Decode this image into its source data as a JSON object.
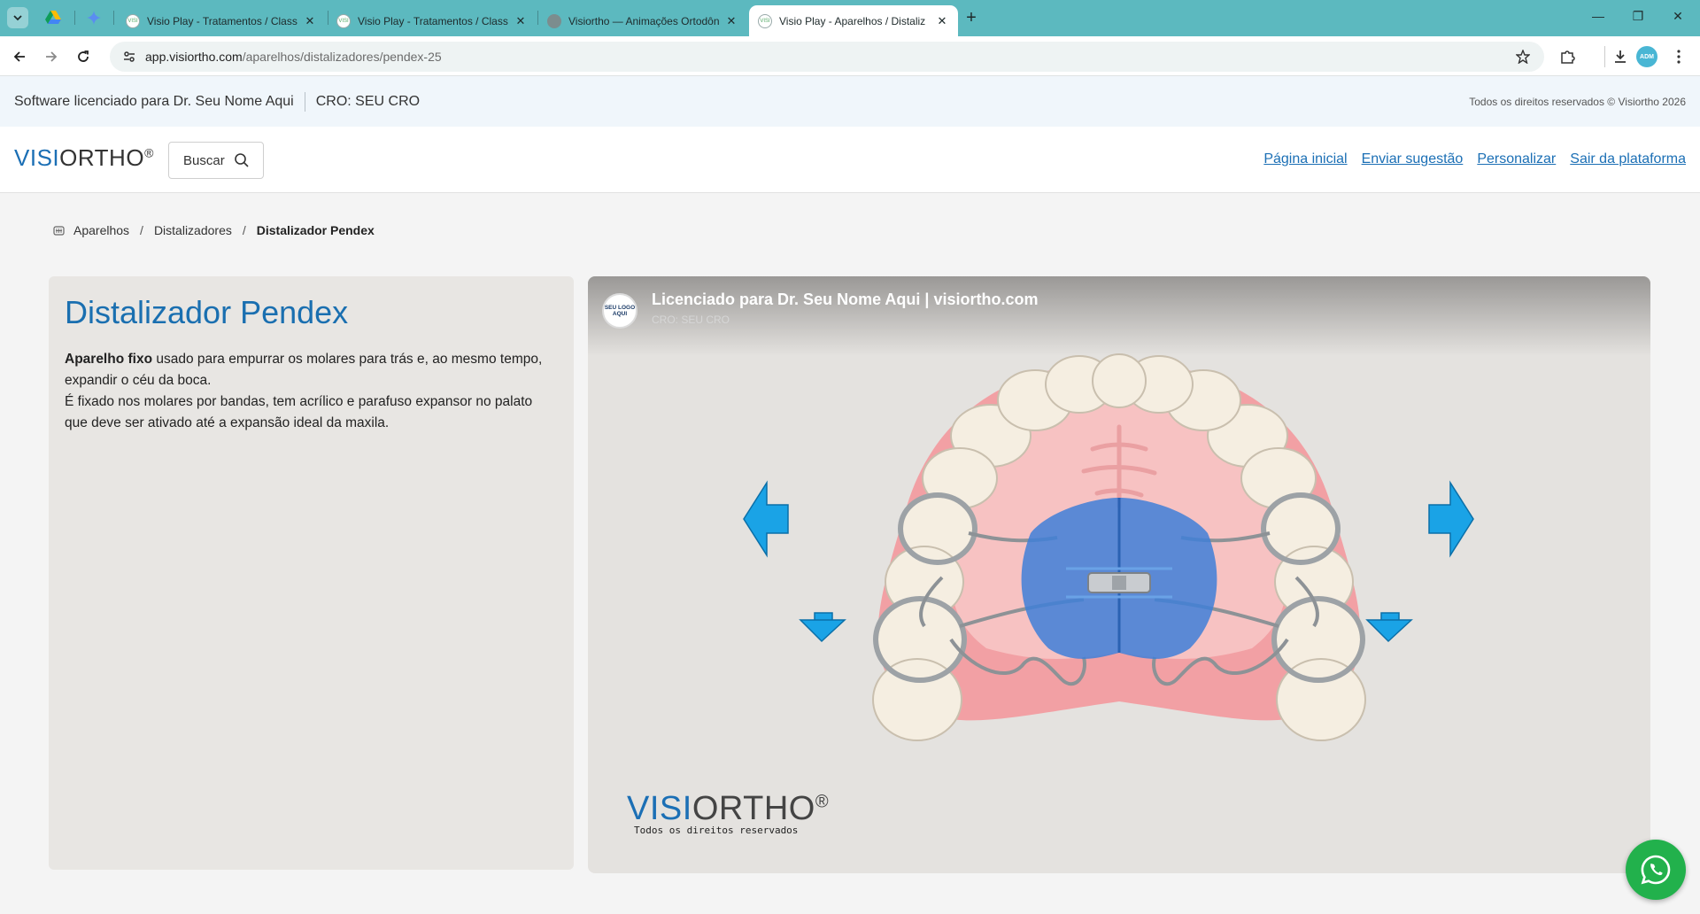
{
  "browser": {
    "tabs": [
      {
        "title": "Visio Play - Tratamentos / Classe",
        "favicon": "visio-icon"
      },
      {
        "title": "Visio Play - Tratamentos / Classe",
        "favicon": "visio-icon"
      },
      {
        "title": "Visiortho — Animações Ortodônticas",
        "favicon": "globe-icon"
      },
      {
        "title": "Visio Play - Aparelhos / Distaliz",
        "favicon": "visio-icon",
        "active": true
      }
    ],
    "pinned": [
      "google-drive-icon",
      "gemini-icon"
    ],
    "url_host": "app.visiortho.com",
    "url_path": "/aparelhos/distalizadores/pendex-25",
    "profile_label": "ADM"
  },
  "license_bar": {
    "licensed_to": "Software licenciado para Dr. Seu Nome Aqui",
    "cro": "CRO: SEU CRO",
    "rights": "Todos os direitos reservados © Visiortho 2026"
  },
  "header": {
    "brand_visi": "VISI",
    "brand_ortho": "ORTHO",
    "brand_reg": "®",
    "search_label": "Buscar",
    "nav": [
      "Página inicial",
      "Enviar sugestão",
      "Personalizar",
      "Sair da plataforma"
    ]
  },
  "breadcrumb": {
    "items": [
      "Aparelhos",
      "Distalizadores"
    ],
    "separator": "/",
    "current": "Distalizador Pendex"
  },
  "info": {
    "title": "Distalizador Pendex",
    "desc_bold": "Aparelho  fixo",
    "desc_line1": " usado para empurrar os molares para trás e, ao mesmo tempo, expandir o céu da boca.",
    "desc_line2": "É fixado nos molares por bandas, tem acrílico e parafuso expansor no palato que deve ser ativado até a expansão ideal da maxila."
  },
  "video": {
    "seal_text": "SEU LOGO AQUI",
    "license_text": "Licenciado para Dr. Seu Nome Aqui | visiortho.com",
    "cro_text": "CRO: SEU CRO",
    "wm_visi": "VISI",
    "wm_ortho": "ORTHO",
    "wm_reg": "®",
    "wm_rights": "Todos os direitos reservados"
  },
  "colors": {
    "tabbar": "#5cb9bf",
    "brand_blue": "#1b6fb5",
    "link_blue": "#1b6fb5",
    "whatsapp_green": "#22b14c",
    "arrow_blue": "#1aa3e6"
  }
}
